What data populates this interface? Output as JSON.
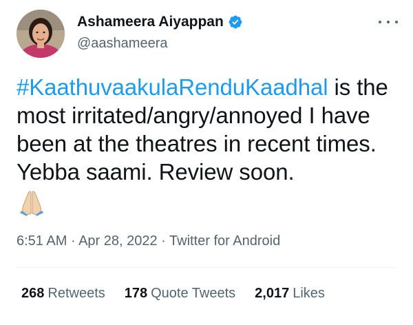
{
  "author": {
    "display_name": "Ashameera Aiyappan",
    "handle": "@aashameera",
    "verified_icon": "verified-badge-icon",
    "verified_color": "#1d9bf0"
  },
  "tweet": {
    "hashtag": "#KaathuvaakulaRenduKaadhal",
    "text_after_hashtag": " is the most irritated/angry/annoyed I have been at the theatres in recent times. Yebba saami. Review soon.",
    "emoji": "folded-hands-icon"
  },
  "meta": {
    "time": "6:51 AM",
    "date": "Apr 28, 2022",
    "source": "Twitter for Android",
    "separator": "·"
  },
  "stats": {
    "retweets_count": "268",
    "retweets_label": "Retweets",
    "quotes_count": "178",
    "quotes_label": "Quote Tweets",
    "likes_count": "2,017",
    "likes_label": "Likes"
  },
  "colors": {
    "link": "#1d9bf0",
    "secondary_text": "#536471",
    "primary_text": "#0f1419"
  }
}
